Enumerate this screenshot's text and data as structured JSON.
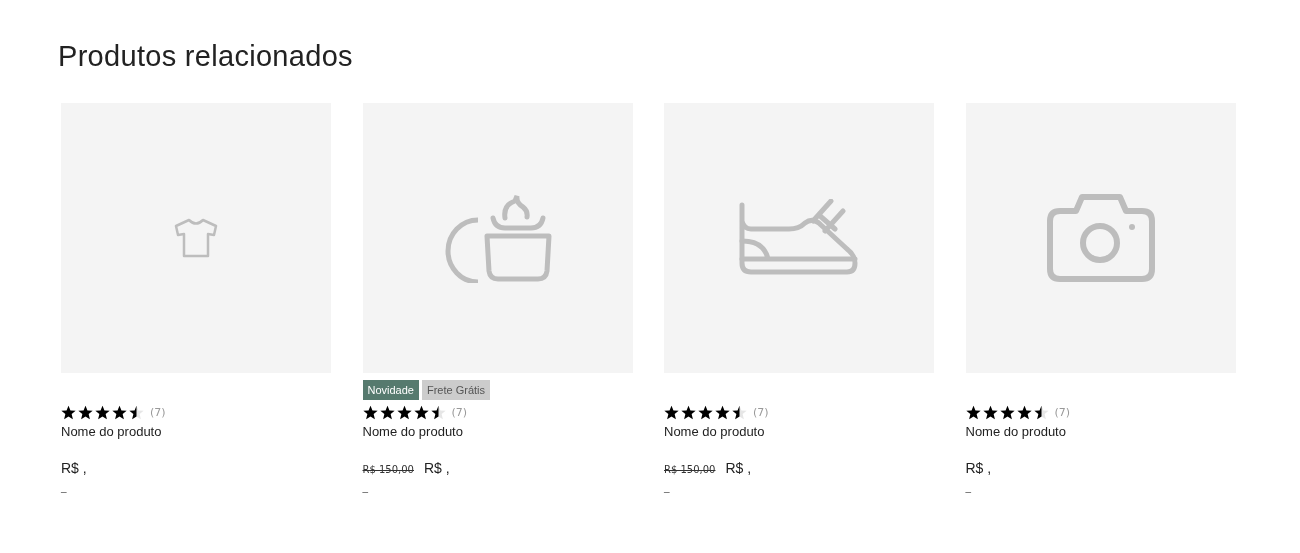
{
  "heading": "Produtos relacionados",
  "products": [
    {
      "kind": "shirt",
      "stars": 4.5,
      "review_count": "(7)",
      "name": "Nome do produto",
      "price": "R$ ,",
      "installments": "_"
    },
    {
      "kind": "cupcake",
      "badges": [
        {
          "label": "Novidade",
          "color": "#567a6e"
        },
        {
          "label": "Frete Grátis",
          "color": "#cccccc"
        }
      ],
      "stars": 4.5,
      "review_count": "(7)",
      "name": "Nome do produto",
      "old_price": "R$ 150,00",
      "price": "R$ ,",
      "installments": "_"
    },
    {
      "kind": "shoe",
      "stars": 4.5,
      "review_count": "(7)",
      "name": "Nome do produto",
      "old_price": "R$ 150,00",
      "price": "R$ ,",
      "installments": "_"
    },
    {
      "kind": "camera",
      "stars": 4.5,
      "review_count": "(7)",
      "name": "Nome do produto",
      "price": "R$ ,",
      "installments": "_"
    }
  ]
}
